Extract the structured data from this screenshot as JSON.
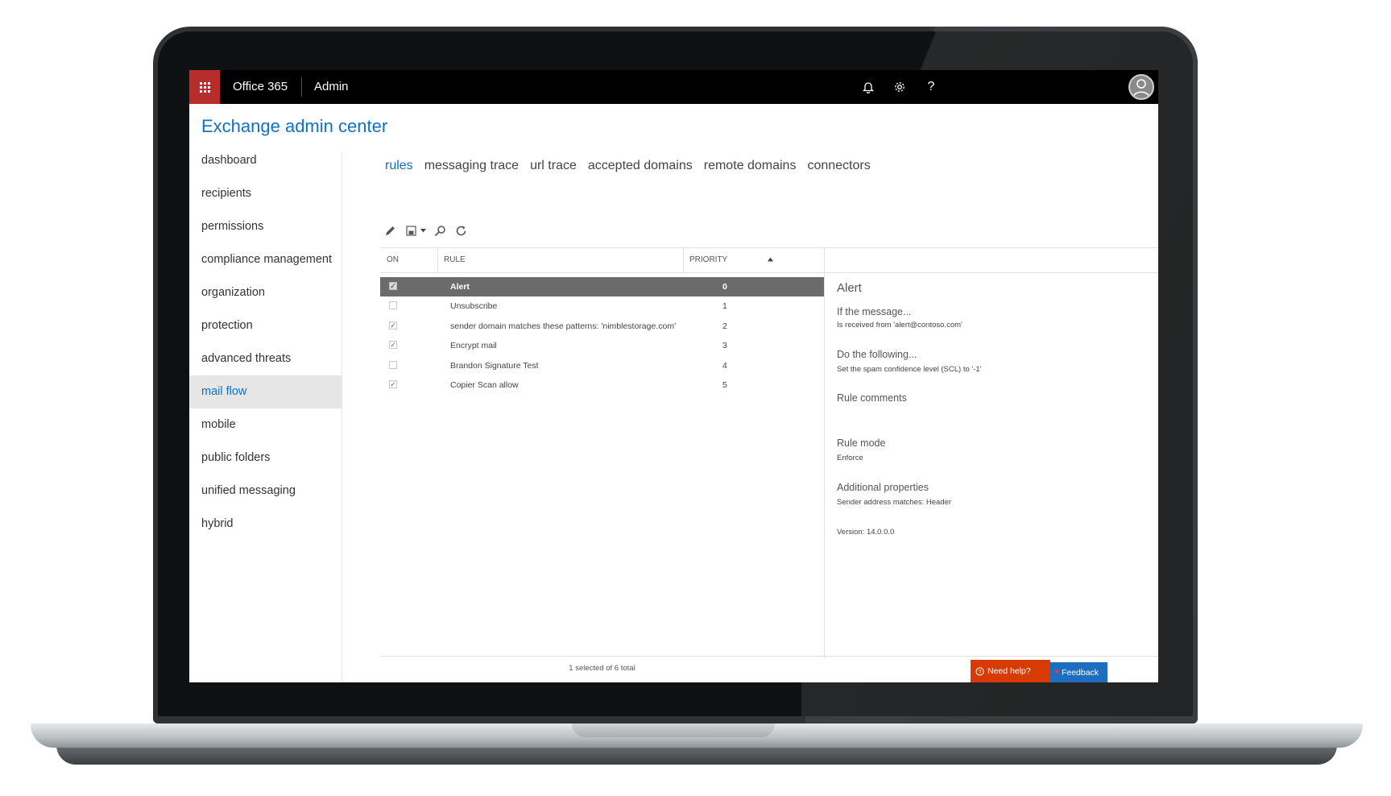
{
  "topbar": {
    "brand": "Office 365",
    "section": "Admin",
    "icons": [
      "bell-icon",
      "gear-icon",
      "help-icon"
    ]
  },
  "page_title": "Exchange admin center",
  "nav": {
    "items": [
      {
        "label": "dashboard"
      },
      {
        "label": "recipients"
      },
      {
        "label": "permissions"
      },
      {
        "label": "compliance management"
      },
      {
        "label": "organization"
      },
      {
        "label": "protection"
      },
      {
        "label": "advanced threats"
      },
      {
        "label": "mail flow",
        "active": true
      },
      {
        "label": "mobile"
      },
      {
        "label": "public folders"
      },
      {
        "label": "unified messaging"
      },
      {
        "label": "hybrid"
      }
    ]
  },
  "tabs": [
    {
      "label": "rules",
      "active": true
    },
    {
      "label": "messaging trace"
    },
    {
      "label": "url trace"
    },
    {
      "label": "accepted domains"
    },
    {
      "label": "remote domains"
    },
    {
      "label": "connectors"
    }
  ],
  "toolbar": {
    "icons": [
      "edit-pencil-icon",
      "save-icon",
      "dropdown-caret-icon",
      "search-icon",
      "refresh-icon"
    ]
  },
  "grid": {
    "headers": {
      "on": "ON",
      "rule": "RULE",
      "priority": "PRIORITY"
    },
    "rows": [
      {
        "on": true,
        "rule": "Alert",
        "priority": "0",
        "selected": true
      },
      {
        "on": false,
        "rule": "Unsubscribe",
        "priority": "1"
      },
      {
        "on": true,
        "rule": "sender domain matches these patterns: 'nimblestorage.com'",
        "priority": "2"
      },
      {
        "on": true,
        "rule": "Encrypt mail",
        "priority": "3"
      },
      {
        "on": false,
        "rule": "Brandon Signature Test",
        "priority": "4"
      },
      {
        "on": true,
        "rule": "Copier Scan allow",
        "priority": "5"
      }
    ],
    "footer": "1 selected of 6 total"
  },
  "detail": {
    "title": "Alert",
    "if_heading": "If the message...",
    "if_value": "Is received from 'alert@contoso.com'",
    "do_heading": "Do the following...",
    "do_value": "Set the spam confidence level (SCL) to '-1'",
    "comments_heading": "Rule comments",
    "mode_heading": "Rule mode",
    "mode_value": "Enforce",
    "props_heading": "Additional properties",
    "props_value": "Sender address matches: Header",
    "version": "Version: 14.0.0.0"
  },
  "buttons": {
    "help": "Need help?",
    "feedback": "Feedback"
  },
  "colors": {
    "accent": "#0f72c6",
    "waffle": "#b92c2c",
    "help_button": "#d83b01",
    "feedback_button": "#1e6ec0"
  }
}
